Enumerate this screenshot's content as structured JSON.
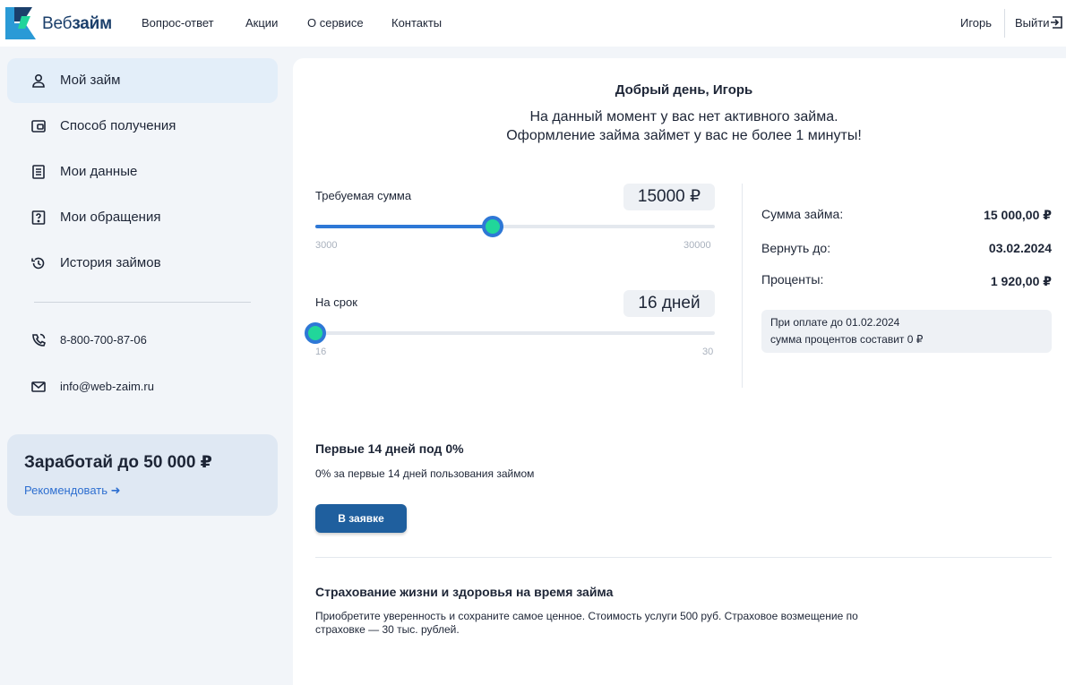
{
  "brand": {
    "name_light": "Веб",
    "name_bold": "займ"
  },
  "nav": {
    "items": [
      {
        "label": "Вопрос-ответ"
      },
      {
        "label": "Акции"
      },
      {
        "label": "О сервисе"
      },
      {
        "label": "Контакты"
      }
    ],
    "user_name": "Игорь",
    "logout_label": "Выйти"
  },
  "sidebar": {
    "items": [
      {
        "label": "Мой займ",
        "icon": "user-icon",
        "active": true
      },
      {
        "label": "Способ получения",
        "icon": "wallet-icon"
      },
      {
        "label": "Мои данные",
        "icon": "document-icon"
      },
      {
        "label": "Мои обращения",
        "icon": "help-icon"
      },
      {
        "label": "История займов",
        "icon": "history-icon"
      }
    ],
    "phone": "8-800-700-87-06",
    "email": "info@web-zaim.ru",
    "promo": {
      "title": "Заработай до 50 000 ₽",
      "link": "Рекомендовать ➜"
    }
  },
  "main": {
    "greeting": "Добрый день, Игорь",
    "subtitle_line1": "На данный момент у вас нет активного займа.",
    "subtitle_line2": "Оформление займа займет у вас не более 1 минуты!",
    "amount": {
      "label": "Требуемая сумма",
      "value_text": "15000 ₽",
      "value": 15000,
      "min": 3000,
      "max": 30000,
      "min_label": "3000",
      "max_label": "30000"
    },
    "term": {
      "label": "На срок",
      "value_text": "16 дней",
      "value": 16,
      "min": 16,
      "max": 30,
      "min_label": "16",
      "max_label": "30"
    },
    "summary": {
      "sum_label": "Сумма займа:",
      "sum_value": "15 000,00 ₽",
      "return_label": "Вернуть до:",
      "return_value": "03.02.2024",
      "interest_label": "Проценты:",
      "interest_value": "1 920,00 ₽",
      "note_line1": "При оплате до 01.02.2024",
      "note_line2": "сумма процентов составит 0 ₽"
    },
    "offer": {
      "title": "Первые 14 дней под 0%",
      "description": "0% за первые 14 дней пользования займом",
      "button": "В заявке"
    },
    "insurance": {
      "title": "Страхование жизни и здоровья на время займа",
      "description": "Приобретите уверенность и сохраните самое ценное. Стоимость услуги 500 руб. Страховое возмещение по страховке — 30 тыс. рублей."
    }
  },
  "colors": {
    "accent": "#2e78d6",
    "thumb": "#21d69a",
    "button": "#1f5f9e",
    "link": "#2e6fd0",
    "active_bg": "#e3eef9"
  }
}
